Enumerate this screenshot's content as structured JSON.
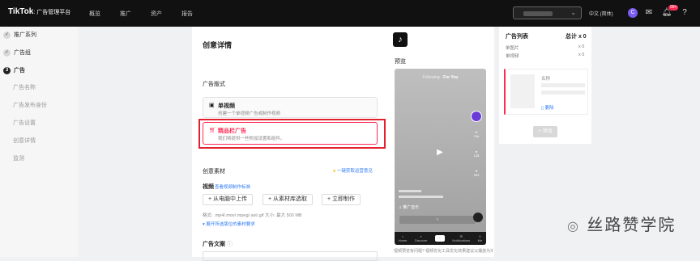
{
  "topbar": {
    "logo": "TikTok",
    "logo_sub": ": 广告管理平台",
    "nav": [
      "概览",
      "推广",
      "资产",
      "报告"
    ],
    "language": "中文 (简体)",
    "avatar_letter": "C",
    "notification_count": "99+"
  },
  "sidebar": {
    "steps": [
      {
        "label": "推广系列",
        "mark": "✓"
      },
      {
        "label": "广告组",
        "mark": "✓"
      },
      {
        "label": "广告",
        "mark": "3"
      }
    ],
    "sub_steps": [
      "广告名称",
      "广告发布身份",
      "广告设置",
      "创意详情",
      "监测"
    ]
  },
  "main": {
    "title": "创意详情",
    "ad_format_label": "广告版式",
    "formats": [
      {
        "title": "单视频",
        "desc": "创建一个单视频广告或制作视频"
      },
      {
        "title": "精品栏广告",
        "desc": "我们将提供一些附加设置和组件。"
      }
    ],
    "creative_label": "创意素材",
    "creative_link": "一键获取运营意见",
    "video_label": "视频",
    "video_link": "查看视频制作标准",
    "buttons": [
      "+ 从电脑中上传",
      "+ 从素材库选取",
      "+ 立即制作"
    ],
    "format_note": "格式: .mp4/.mov/.mpeg/.avi/.gif  大小: 最大 500 MB",
    "expand_link": "▾ 展开所选版位的素材要求",
    "ad_text_label": "广告文案"
  },
  "preview": {
    "label": "预览",
    "tab_following": "Following",
    "tab_foryou": "For You",
    "side_counts": [
      "11k",
      "128",
      "263"
    ],
    "music": "♫ 推广音乐",
    "bottom_tabs": [
      "Home",
      "Discover",
      "",
      "Notifications",
      "Me"
    ],
    "footer": "视频预览有问题? 视频优化工具优化效果建议以播放为准"
  },
  "ad_list": {
    "title": "广告列表",
    "total": "总计 x 0",
    "rows": [
      {
        "label": "单图片",
        "value": "x 0"
      },
      {
        "label": "单视频",
        "value": "x 0"
      }
    ],
    "name_label": "名称",
    "delete_label": "删除",
    "add_button": "+ 添加"
  },
  "watermark": "丝路赞学院",
  "colors": {
    "accent": "#fe2c55",
    "highlight": "#e3202e",
    "link": "#2f7cf6",
    "topbar": "#111111"
  }
}
